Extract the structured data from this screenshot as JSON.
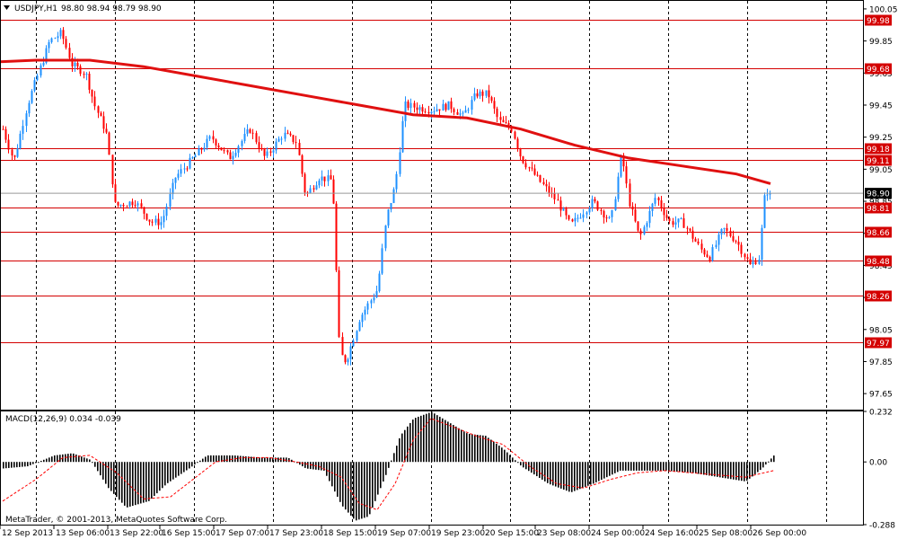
{
  "header": {
    "symbol_label": "USDJPY,H1",
    "ohlc": "98.80 98.94 98.79 98.90",
    "macd_label": "MACD(12,26,9) 0.034 -0.039",
    "copyright": "MetaTrader, © 2001-2013, MetaQuotes Software Corp."
  },
  "colors": {
    "up": "#1e90ff",
    "down": "#ff0000",
    "ma": "#e01010",
    "level": "#d40000",
    "grid": "#000000",
    "macd_hist": "#000000",
    "macd_signal": "#ff0000"
  },
  "chart_data": [
    {
      "type": "candlestick",
      "title": "USDJPY,H1",
      "ylim": [
        97.55,
        100.1
      ],
      "y_ticks": [
        "100.05",
        "99.85",
        "99.65",
        "99.45",
        "99.25",
        "99.05",
        "98.85",
        "98.65",
        "98.45",
        "98.25",
        "98.05",
        "97.85",
        "97.65"
      ],
      "x_ticks": [
        "12 Sep 2013",
        "13 Sep 06:00",
        "13 Sep 22:00",
        "16 Sep 15:00",
        "17 Sep 07:00",
        "17 Sep 23:00",
        "18 Sep 15:00",
        "19 Sep 07:00",
        "19 Sep 23:00",
        "20 Sep 15:00",
        "23 Sep 08:00",
        "24 Sep 00:00",
        "24 Sep 16:00",
        "25 Sep 08:00",
        "26 Sep 00:00"
      ],
      "current_price": "98.90",
      "levels": [
        "99.98",
        "99.68",
        "99.18",
        "99.11",
        "98.81",
        "98.66",
        "98.48",
        "98.26",
        "97.97"
      ],
      "moving_average": [
        [
          0,
          99.72
        ],
        [
          40,
          99.73
        ],
        [
          100,
          99.73
        ],
        [
          160,
          99.69
        ],
        [
          220,
          99.63
        ],
        [
          280,
          99.57
        ],
        [
          340,
          99.51
        ],
        [
          400,
          99.45
        ],
        [
          460,
          99.39
        ],
        [
          520,
          99.37
        ],
        [
          580,
          99.3
        ],
        [
          640,
          99.2
        ],
        [
          700,
          99.12
        ],
        [
          760,
          99.07
        ],
        [
          820,
          99.02
        ],
        [
          858,
          98.96
        ]
      ],
      "price_path": [
        [
          3,
          99.3
        ],
        [
          15,
          99.1
        ],
        [
          30,
          99.45
        ],
        [
          55,
          99.85
        ],
        [
          68,
          99.9
        ],
        [
          80,
          99.7
        ],
        [
          95,
          99.65
        ],
        [
          105,
          99.45
        ],
        [
          118,
          99.28
        ],
        [
          128,
          98.82
        ],
        [
          150,
          98.85
        ],
        [
          168,
          98.72
        ],
        [
          180,
          98.72
        ],
        [
          195,
          99.0
        ],
        [
          215,
          99.12
        ],
        [
          235,
          99.25
        ],
        [
          255,
          99.12
        ],
        [
          278,
          99.3
        ],
        [
          295,
          99.12
        ],
        [
          315,
          99.27
        ],
        [
          330,
          99.22
        ],
        [
          340,
          98.88
        ],
        [
          355,
          99.0
        ],
        [
          370,
          98.98
        ],
        [
          378,
          97.9
        ],
        [
          385,
          97.85
        ],
        [
          400,
          98.12
        ],
        [
          420,
          98.3
        ],
        [
          430,
          98.75
        ],
        [
          440,
          98.95
        ],
        [
          450,
          99.45
        ],
        [
          480,
          99.42
        ],
        [
          500,
          99.45
        ],
        [
          515,
          99.38
        ],
        [
          530,
          99.52
        ],
        [
          543,
          99.52
        ],
        [
          555,
          99.35
        ],
        [
          570,
          99.3
        ],
        [
          580,
          99.12
        ],
        [
          600,
          98.98
        ],
        [
          620,
          98.85
        ],
        [
          635,
          98.7
        ],
        [
          660,
          98.85
        ],
        [
          680,
          98.72
        ],
        [
          692,
          99.15
        ],
        [
          700,
          98.85
        ],
        [
          712,
          98.62
        ],
        [
          730,
          98.88
        ],
        [
          745,
          98.72
        ],
        [
          760,
          98.72
        ],
        [
          780,
          98.55
        ],
        [
          790,
          98.5
        ],
        [
          805,
          98.68
        ],
        [
          820,
          98.6
        ],
        [
          835,
          98.45
        ],
        [
          845,
          98.5
        ],
        [
          852,
          98.93
        ],
        [
          858,
          98.88
        ]
      ]
    },
    {
      "type": "bar",
      "title": "MACD(12,26,9)",
      "ylim": [
        -0.288,
        0.232
      ],
      "y_ticks": [
        "0.232",
        "0.00",
        "-0.288"
      ],
      "macd_path": [
        [
          3,
          -0.03
        ],
        [
          30,
          -0.02
        ],
        [
          60,
          0.03
        ],
        [
          80,
          0.04
        ],
        [
          100,
          0.01
        ],
        [
          120,
          -0.12
        ],
        [
          140,
          -0.21
        ],
        [
          165,
          -0.18
        ],
        [
          185,
          -0.1
        ],
        [
          210,
          -0.03
        ],
        [
          230,
          0.03
        ],
        [
          260,
          0.03
        ],
        [
          290,
          0.02
        ],
        [
          320,
          0.02
        ],
        [
          340,
          -0.03
        ],
        [
          360,
          -0.04
        ],
        [
          380,
          -0.2
        ],
        [
          395,
          -0.27
        ],
        [
          410,
          -0.25
        ],
        [
          430,
          -0.05
        ],
        [
          445,
          0.12
        ],
        [
          460,
          0.2
        ],
        [
          480,
          0.23
        ],
        [
          500,
          0.18
        ],
        [
          520,
          0.13
        ],
        [
          540,
          0.12
        ],
        [
          560,
          0.06
        ],
        [
          580,
          -0.02
        ],
        [
          610,
          -0.1
        ],
        [
          635,
          -0.14
        ],
        [
          660,
          -0.1
        ],
        [
          690,
          -0.04
        ],
        [
          710,
          -0.04
        ],
        [
          740,
          -0.04
        ],
        [
          770,
          -0.05
        ],
        [
          800,
          -0.07
        ],
        [
          830,
          -0.09
        ],
        [
          848,
          -0.03
        ],
        [
          862,
          0.034
        ]
      ],
      "signal_path": [
        [
          3,
          -0.18
        ],
        [
          40,
          -0.08
        ],
        [
          70,
          0.02
        ],
        [
          100,
          0.03
        ],
        [
          130,
          -0.05
        ],
        [
          160,
          -0.17
        ],
        [
          190,
          -0.16
        ],
        [
          215,
          -0.08
        ],
        [
          240,
          0.0
        ],
        [
          270,
          0.02
        ],
        [
          300,
          0.02
        ],
        [
          330,
          0.0
        ],
        [
          355,
          -0.02
        ],
        [
          380,
          -0.07
        ],
        [
          400,
          -0.19
        ],
        [
          420,
          -0.22
        ],
        [
          440,
          -0.1
        ],
        [
          460,
          0.1
        ],
        [
          480,
          0.2
        ],
        [
          505,
          0.16
        ],
        [
          530,
          0.12
        ],
        [
          560,
          0.08
        ],
        [
          590,
          -0.02
        ],
        [
          620,
          -0.1
        ],
        [
          650,
          -0.12
        ],
        [
          680,
          -0.08
        ],
        [
          710,
          -0.05
        ],
        [
          740,
          -0.04
        ],
        [
          770,
          -0.05
        ],
        [
          800,
          -0.06
        ],
        [
          830,
          -0.07
        ],
        [
          862,
          -0.039
        ]
      ]
    }
  ]
}
